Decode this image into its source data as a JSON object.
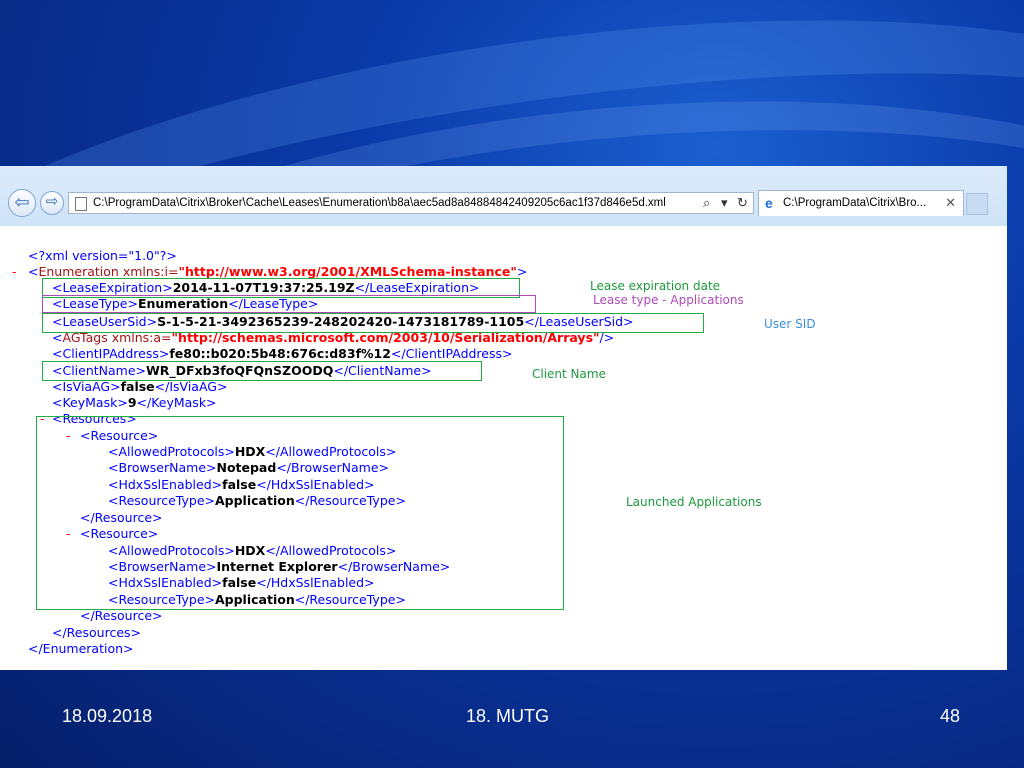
{
  "browser": {
    "address_url": "C:\\ProgramData\\Citrix\\Broker\\Cache\\Leases\\Enumeration\\b8a\\aec5ad8a84884842409205c6ac1f37d846e5d.xml",
    "search_glyph": "⌕",
    "dropdown_glyph": "▾",
    "refresh_glyph": "↻",
    "tab_title": "C:\\ProgramData\\Citrix\\Bro...",
    "tab_close": "✕",
    "back_glyph": "⇦",
    "forward_glyph": "⇨",
    "ie_glyph": "e"
  },
  "xml": {
    "decl": "<?xml version=\"1.0\"?>",
    "enum_open_pre": "<Enumeration ",
    "enum_attr": "xmlns:i=",
    "enum_ns": "\"http://www.w3.org/2001/XMLSchema-instance\"",
    "enum_open_post": ">",
    "lease_exp_open": "<LeaseExpiration>",
    "lease_exp_val": "2014-11-07T19:37:25.19Z",
    "lease_exp_close": "</LeaseExpiration>",
    "lease_type_open": "<LeaseType>",
    "lease_type_val": "Enumeration",
    "lease_type_close": "</LeaseType>",
    "lease_sid_open": "<LeaseUserSid>",
    "lease_sid_val": "S-1-5-21-3492365239-248202420-1473181789-1105",
    "lease_sid_close": "</LeaseUserSid>",
    "agtags_open_pre": "<AGTags ",
    "agtags_attr": "xmlns:a=",
    "agtags_ns": "\"http://schemas.microsoft.com/2003/10/Serialization/Arrays\"",
    "agtags_close": "/>",
    "clientip_open": "<ClientIPAddress>",
    "clientip_val": "fe80::b020:5b48:676c:d83f%12",
    "clientip_close": "</ClientIPAddress>",
    "clientname_open": "<ClientName>",
    "clientname_val": "WR_DFxb3foQFQnSZOODQ",
    "clientname_close": "</ClientName>",
    "isviaag_open": "<IsViaAG>",
    "isviaag_val": "false",
    "isviaag_close": "</IsViaAG>",
    "keymask_open": "<KeyMask>",
    "keymask_val": "9",
    "keymask_close": "</KeyMask>",
    "resources_open": "<Resources>",
    "resource_open": "<Resource>",
    "resource_close": "</Resource>",
    "resources_close": "</Resources>",
    "enum_close": "</Enumeration>",
    "collapse": "-",
    "resources": [
      {
        "ap_open": "<AllowedProtocols>",
        "ap_val": "HDX",
        "ap_close": "</AllowedProtocols>",
        "bn_open": "<BrowserName>",
        "bn_val": "Notepad",
        "bn_close": "</BrowserName>",
        "ssl_open": "<HdxSslEnabled>",
        "ssl_val": "false",
        "ssl_close": "</HdxSslEnabled>",
        "rt_open": "<ResourceType>",
        "rt_val": "Application",
        "rt_close": "</ResourceType>"
      },
      {
        "ap_open": "<AllowedProtocols>",
        "ap_val": "HDX",
        "ap_close": "</AllowedProtocols>",
        "bn_open": "<BrowserName>",
        "bn_val": "Internet Explorer",
        "bn_close": "</BrowserName>",
        "ssl_open": "<HdxSslEnabled>",
        "ssl_val": "false",
        "ssl_close": "</HdxSslEnabled>",
        "rt_open": "<ResourceType>",
        "rt_val": "Application",
        "rt_close": "</ResourceType>"
      }
    ]
  },
  "annotations": {
    "lease_expiration": "Lease expiration date",
    "lease_type": "Lease type - Applications",
    "user_sid": "User SID",
    "client_name": "Client Name",
    "launched_apps": "Launched Applications",
    "green": "#22aa44",
    "magenta": "#b04ab8",
    "label_green": "#1e9a3c",
    "label_magenta": "#b04ab8",
    "label_blue": "#3b8fd6"
  },
  "footer": {
    "date": "18.09.2018",
    "title": "18. MUTG",
    "page": "48"
  }
}
